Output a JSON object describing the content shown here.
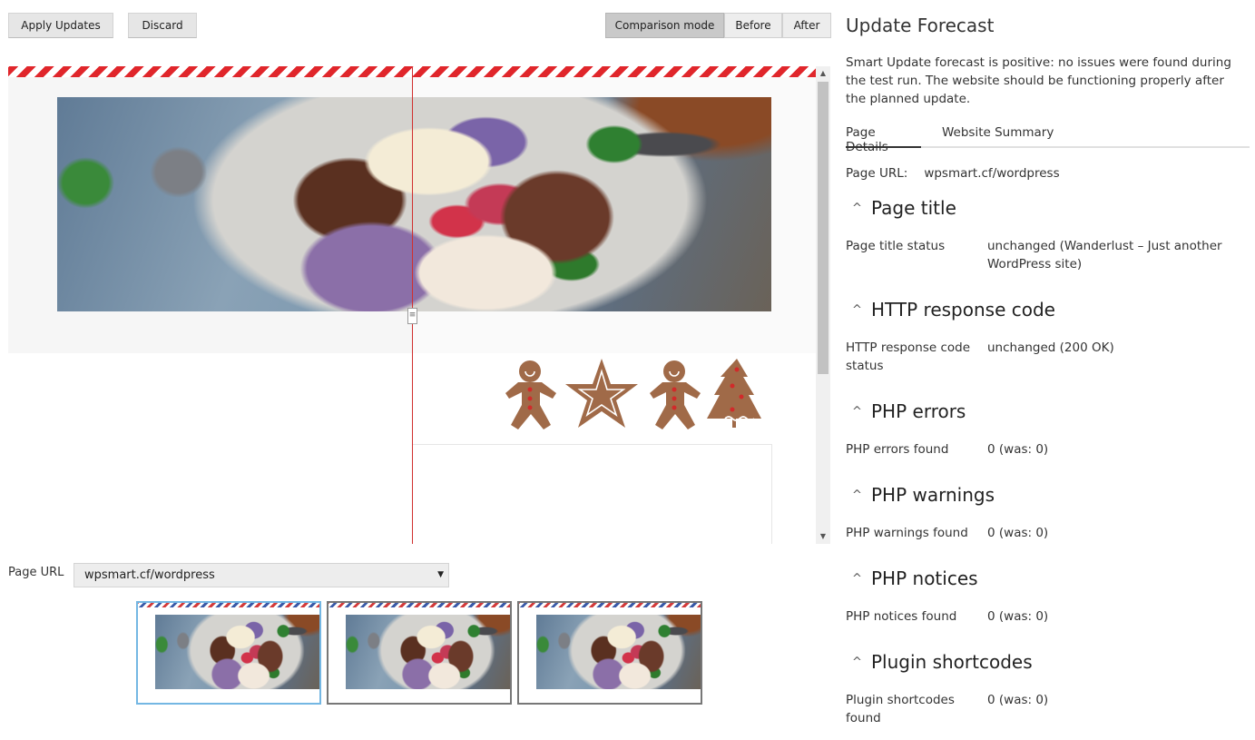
{
  "toolbar": {
    "apply_label": "Apply Updates",
    "discard_label": "Discard",
    "modes": [
      "Comparison mode",
      "Before",
      "After"
    ]
  },
  "preview": {
    "handle_glyph": "≡",
    "scroll_up": "▲",
    "scroll_down": "▼"
  },
  "url_picker": {
    "label": "Page URL",
    "value": "wpsmart.cf/wordpress",
    "caret": "▼"
  },
  "panel": {
    "title": "Update Forecast",
    "description": "Smart Update forecast is positive: no issues were found during the test run. The website should be functioning properly after the planned update.",
    "tabs": [
      "Page Details",
      "Website Summary"
    ],
    "page_url_label": "Page URL:",
    "page_url_value": "wpsmart.cf/wordpress",
    "chevron": "^",
    "sections": [
      {
        "title": "Page title",
        "key": "Page title status",
        "value": "unchanged (Wanderlust – Just another WordPress site)"
      },
      {
        "title": "HTTP response code",
        "key": "HTTP response code status",
        "value": "unchanged (200 OK)"
      },
      {
        "title": "PHP errors",
        "key": "PHP errors found",
        "value": "0 (was: 0)"
      },
      {
        "title": "PHP warnings",
        "key": "PHP warnings found",
        "value": "0 (was: 0)"
      },
      {
        "title": "PHP notices",
        "key": "PHP notices found",
        "value": "0 (was: 0)"
      },
      {
        "title": "Plugin shortcodes",
        "key": "Plugin shortcodes found",
        "value": "0 (was: 0)"
      }
    ]
  },
  "colors": {
    "accent_red": "#e0262b",
    "active_thumb_border": "#74b7e3",
    "cookie_brown": "#a06a48"
  }
}
